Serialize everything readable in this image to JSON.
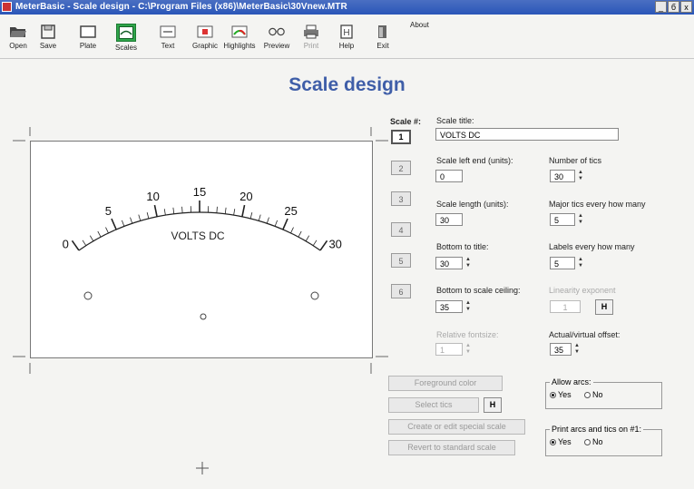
{
  "window": {
    "title": "MeterBasic - Scale design - C:\\Program Files (x86)\\MeterBasic\\30Vnew.MTR",
    "controls": [
      "_",
      "б",
      "x"
    ]
  },
  "toolbar": {
    "items": [
      {
        "label": "Open",
        "icon": "folder-open-icon"
      },
      {
        "label": "Save",
        "icon": "floppy-disk-icon"
      },
      {
        "label": "Plate",
        "icon": "plate-icon"
      },
      {
        "label": "Scales",
        "icon": "scales-icon"
      },
      {
        "label": "Text",
        "icon": "text-icon"
      },
      {
        "label": "Graphic",
        "icon": "graphic-icon"
      },
      {
        "label": "Highlights",
        "icon": "highlights-icon"
      },
      {
        "label": "Preview",
        "icon": "preview-icon"
      },
      {
        "label": "Print",
        "icon": "printer-icon"
      },
      {
        "label": "Help",
        "icon": "help-icon"
      },
      {
        "label": "Exit",
        "icon": "exit-icon"
      }
    ],
    "about_label": "About",
    "active_color": "#2fa54a"
  },
  "page_title": "Scale design",
  "meter": {
    "scale_labels": [
      "0",
      "5",
      "10",
      "15",
      "20",
      "25",
      "30"
    ],
    "unit_label": "VOLTS DC"
  },
  "scale_selector": {
    "label": "Scale #:",
    "buttons": [
      "1",
      "2",
      "3",
      "4",
      "5",
      "6"
    ],
    "selected": "1"
  },
  "form": {
    "scale_title": {
      "label": "Scale title:",
      "value": "VOLTS DC"
    },
    "scale_left_end": {
      "label": "Scale left end (units):",
      "value": "0"
    },
    "number_of_tics": {
      "label": "Number of tics",
      "value": "30"
    },
    "scale_length": {
      "label": "Scale length (units):",
      "value": "30"
    },
    "major_tics": {
      "label": "Major tics every how many",
      "value": "5"
    },
    "bottom_to_title": {
      "label": "Bottom to title:",
      "value": "30"
    },
    "labels_every": {
      "label": "Labels every how many",
      "value": "5"
    },
    "bottom_to_ceiling": {
      "label": "Bottom to scale ceiling:",
      "value": "35"
    },
    "linearity_exponent": {
      "label": "Linearity exponent",
      "value": "1"
    },
    "relative_fontsize": {
      "label": "Relative fontsize:",
      "value": "1"
    },
    "actual_virtual_offset": {
      "label": "Actual/virtual offset:",
      "value": "35"
    }
  },
  "buttons": {
    "foreground_color": "Foreground color",
    "select_tics": "Select tics",
    "create_special_scale": "Create or edit special scale",
    "revert_standard": "Revert to standard scale",
    "h": "H"
  },
  "allow_arcs": {
    "legend": "Allow arcs:",
    "yes": "Yes",
    "no": "No",
    "selected": "yes"
  },
  "print_arcs": {
    "legend": "Print arcs and tics on #1:",
    "yes": "Yes",
    "no": "No",
    "selected": "yes"
  }
}
